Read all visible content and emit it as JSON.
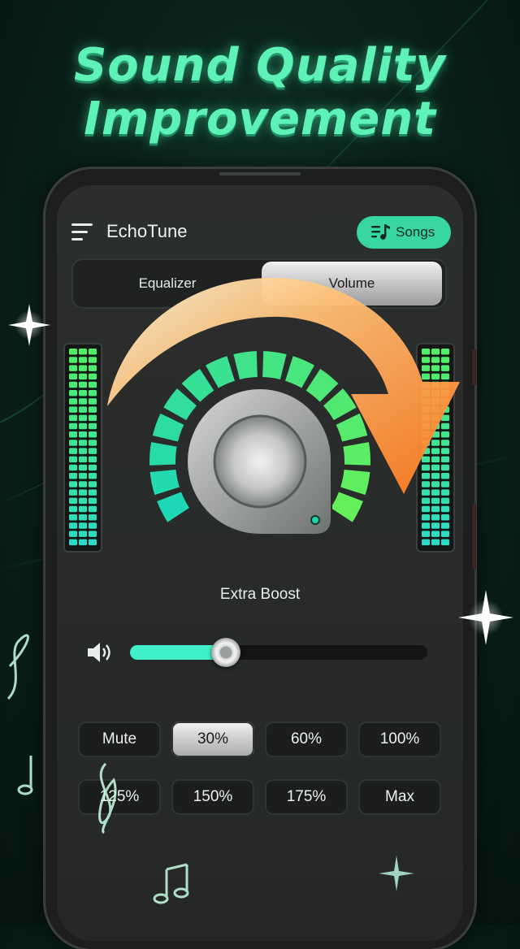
{
  "headline": {
    "line1": "Sound Quality",
    "line2": "Improvement"
  },
  "app": {
    "title": "EchoTune",
    "songs_button": "Songs"
  },
  "tabs": [
    {
      "label": "Equalizer",
      "active": false
    },
    {
      "label": "Volume",
      "active": true
    }
  ],
  "knob": {
    "mode_label": "Extra Boost"
  },
  "volume_slider": {
    "value_fraction": 0.3
  },
  "presets": [
    {
      "label": "Mute",
      "active": false
    },
    {
      "label": "30%",
      "active": true
    },
    {
      "label": "60%",
      "active": false
    },
    {
      "label": "100%",
      "active": false
    },
    {
      "label": "125%",
      "active": false
    },
    {
      "label": "150%",
      "active": false
    },
    {
      "label": "175%",
      "active": false
    },
    {
      "label": "Max",
      "active": false
    }
  ],
  "colors": {
    "accent": "#38d6a0",
    "headline": "#5ef2b6",
    "arrow": "#ff9a3c"
  }
}
